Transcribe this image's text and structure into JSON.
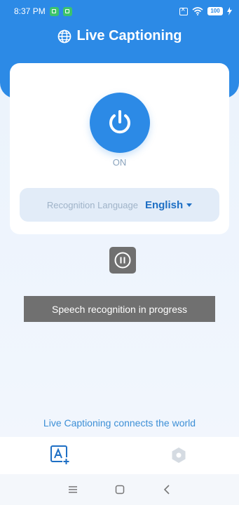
{
  "status_bar": {
    "time": "8:37 PM",
    "battery": "100"
  },
  "header": {
    "title": "Live Captioning",
    "icon": "globe-icon"
  },
  "main": {
    "power_state": "ON",
    "power_icon": "power-icon",
    "language_label": "Recognition Language",
    "language_value": "English"
  },
  "toast": {
    "message": "Speech recognition in progress"
  },
  "footer": {
    "tagline": "Live Captioning connects the world"
  },
  "bottom_nav": {
    "items": [
      {
        "icon": "add-caption-icon",
        "active": true
      },
      {
        "icon": "settings-icon",
        "active": false
      }
    ]
  },
  "colors": {
    "accent": "#2c8ae6",
    "toast_bg": "#707070"
  }
}
